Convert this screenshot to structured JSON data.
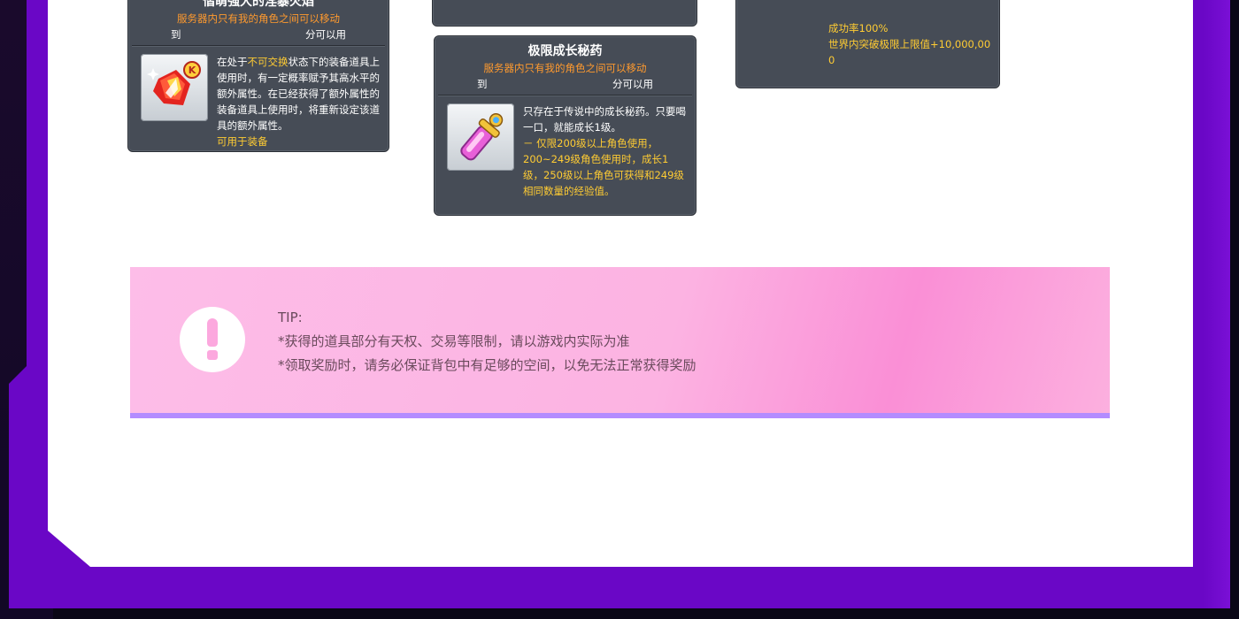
{
  "card1": {
    "title": "偕萌强大的淫暴火焰",
    "subtitle": "服务器内只有我的角色之间可以移动",
    "row_left": "到",
    "row_right": "分可以用",
    "desc_part1": "在处于",
    "desc_highlight": "不可交换",
    "desc_part2": "状态下的装备道具上使用时，有一定概率赋予其高水平的额外属性。在已经获得了额外属性的装备道具上使用时，将重新设定该道具的额外属性。",
    "footer": "可用于装备",
    "icon": "red-flame-cube-icon"
  },
  "card3": {
    "title": "极限成长秘药",
    "subtitle": "服务器内只有我的角色之间可以移动",
    "row_left": "到",
    "row_right": "分可以用",
    "desc_main": "只存在于传说中的成长秘药。只要喝一口，就能成长1级。",
    "desc_note": "－ 仅限200级以上角色使用，200~249级角色使用时，成长1级，250级以上角色可获得和249级相同数量的经验值。",
    "icon": "growth-potion-icon"
  },
  "card4": {
    "line1": "成功率100%",
    "line2": "世界内突破极限上限值+10,000,000"
  },
  "tip": {
    "label": "TIP:",
    "line1": "*获得的道具部分有天权、交易等限制，请以游戏内实际为准",
    "line2": "*领取奖励时，请务必保证背包中有足够的空间，以免无法正常获得奖励",
    "icon": "exclamation-icon"
  },
  "colors": {
    "frame": "#6a07c6",
    "card_bg": "#464c56",
    "orange": "#ff9a2e",
    "yellow": "#ffcc33",
    "tip_bg": "#fcb3e2",
    "tip_border": "#b38cff"
  }
}
